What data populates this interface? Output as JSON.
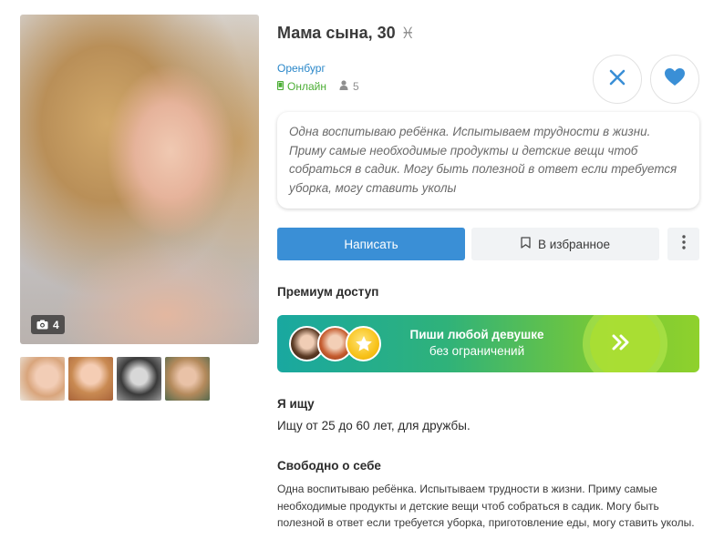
{
  "profile": {
    "name_age": "Мама сына, 30",
    "zodiac_symbol": "♓",
    "zodiac_icon": "pisces-icon",
    "city": "Оренбург",
    "status": "Онлайн",
    "visitors": "5",
    "photo_count": "4",
    "thumbnails": [
      "photo-1",
      "photo-2",
      "photo-3",
      "photo-4"
    ]
  },
  "about_card": {
    "text": "Одна воспитываю ребёнка. Испытываем трудности в жизни. Приму самые необходимые продукты и детские вещи чтоб собраться в садик. Могу быть полезной в ответ если требуется уборка, могу ставить уколы"
  },
  "actions": {
    "write_label": "Написать",
    "favorite_label": "В избранное",
    "close_icon": "close-icon",
    "like_icon": "heart-icon",
    "more_icon": "more-vertical-icon"
  },
  "premium": {
    "section_title": "Премиум доступ",
    "line1": "Пиши любой девушке",
    "line2": "без ограничений",
    "arrow_icon": "double-chevron-right-icon"
  },
  "looking_for": {
    "title": "Я ищу",
    "text": "Ищу от 25 до 60 лет, для дружбы."
  },
  "about_self": {
    "title": "Свободно о себе",
    "text": "Одна воспитываю ребёнка. Испытываем трудности в жизни. Приму самые необходимые продукты и детские вещи чтоб собраться в садик. Могу быть полезной в ответ если требуется уборка, приготовление еды, могу ставить уколы."
  },
  "colors": {
    "accent": "#3a8fd6",
    "online": "#4cae35",
    "link": "#2a87c9",
    "banner_start": "#19a8a0",
    "banner_end": "#8fd12c"
  }
}
